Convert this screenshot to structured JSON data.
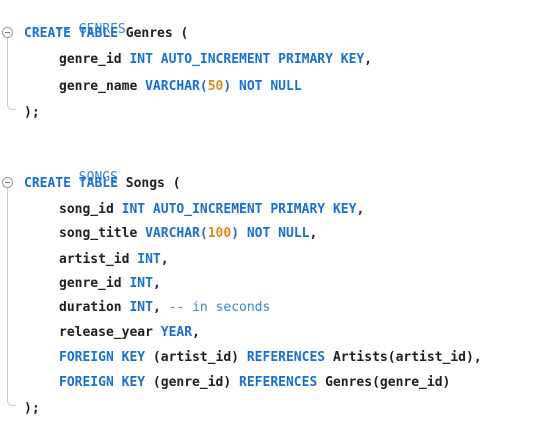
{
  "block1": {
    "comment": "-- GENRES",
    "create_kw": "CREATE TABLE",
    "table_name": " Genres (",
    "col1_name": "genre_id ",
    "col1_type": "INT AUTO_INCREMENT PRIMARY KEY",
    "col1_end": ",",
    "col2_name": "genre_name ",
    "col2_type": "VARCHAR(",
    "col2_len": "50",
    "col2_close": ")",
    "col2_constraint": " NOT NULL",
    "close": ");"
  },
  "block2": {
    "comment": "-- SONGS",
    "create_kw": "CREATE TABLE",
    "table_name": " Songs (",
    "c1_name": "song_id ",
    "c1_type": "INT AUTO_INCREMENT PRIMARY KEY",
    "c1_end": ",",
    "c2_name": "song_title ",
    "c2_type": "VARCHAR(",
    "c2_len": "100",
    "c2_close": ")",
    "c2_constraint": " NOT NULL",
    "c2_end": ",",
    "c3_name": "artist_id ",
    "c3_type": "INT",
    "c3_end": ",",
    "c4_name": "genre_id ",
    "c4_type": "INT",
    "c4_end": ",",
    "c5_name": "duration ",
    "c5_type": "INT",
    "c5_end": ", ",
    "c5_comment": "-- in seconds",
    "c6_name": "release_year ",
    "c6_type": "YEAR",
    "c6_end": ",",
    "fk1_kw": "FOREIGN KEY",
    "fk1_col": " (artist_id) ",
    "fk1_ref": "REFERENCES",
    "fk1_target": " Artists(artist_id),",
    "fk2_kw": "FOREIGN KEY",
    "fk2_col": " (genre_id) ",
    "fk2_ref": "REFERENCES",
    "fk2_target": " Genres(genre_id)",
    "close": ");"
  },
  "colors": {
    "keyword": "#1a6fd0",
    "comment": "#3a86d6",
    "number": "#e08a1a",
    "text": "#202020"
  }
}
